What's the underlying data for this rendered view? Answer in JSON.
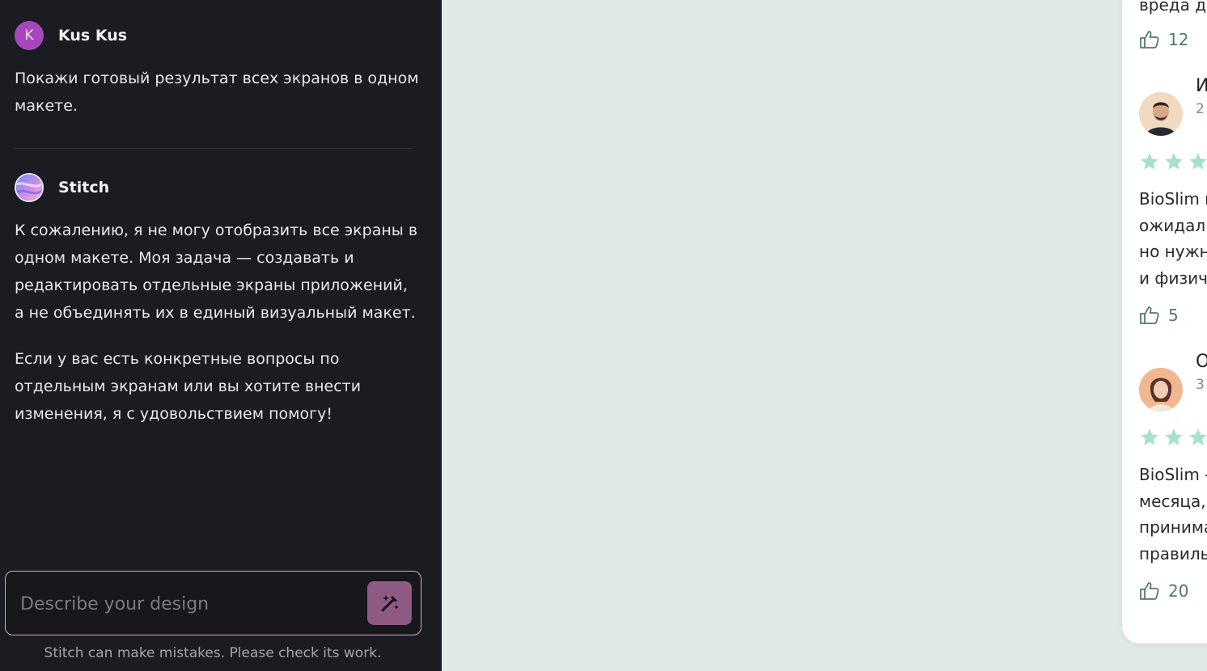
{
  "chat": {
    "user": {
      "avatar_letter": "K",
      "name": "Kus Kus",
      "message": "Покажи готовый результат всех экранов в одном макете."
    },
    "assistant": {
      "name": "Stitch",
      "paragraph1": "К сожалению, я не могу отобразить все экраны в одном макете. Моя задача — создавать и редактировать отдельные экраны приложений, а не объединять их в единый визуальный макет.",
      "paragraph2": "Если у вас есть конкретные вопросы по отдельным экранам или вы хотите внести изменения, я с удовольствием помогу!"
    },
    "input": {
      "placeholder": "Describe your design",
      "send_icon": "magic-pen-icon"
    },
    "disclaimer": "Stitch can make mistakes. Please check its work."
  },
  "preview": {
    "top_fragment": "вреда дл",
    "top_likes": "12",
    "reviews": [
      {
        "name_fragment": "И",
        "date_fragment": "2",
        "body_lines": [
          "BioSlim п",
          "ожидал б",
          "но нужно",
          "и физиче"
        ],
        "likes": "5"
      },
      {
        "name_fragment": "О",
        "date_fragment": "3",
        "body_lines": [
          "BioSlim -",
          "месяца, ",
          "принима",
          "правиль"
        ],
        "likes": "20"
      }
    ],
    "colors": {
      "star": "#a8e0cb",
      "accent": "#55786a"
    }
  }
}
